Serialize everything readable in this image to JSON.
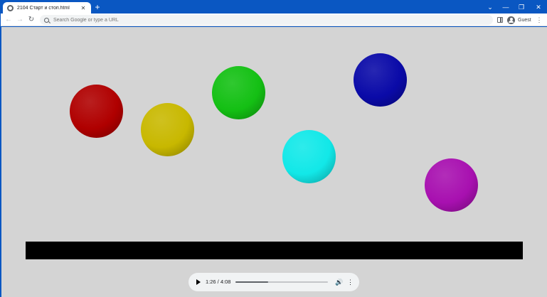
{
  "tab": {
    "title": "2104 Старт и стоп.html",
    "close_glyph": "✕",
    "favicon": "globe-icon"
  },
  "new_tab_glyph": "+",
  "window_controls": {
    "tabsearch": "⌄",
    "minimize": "—",
    "restore": "❐",
    "close": "✕"
  },
  "toolbar": {
    "back_glyph": "←",
    "forward_glyph": "→",
    "reload_glyph": "↻",
    "omnibox_placeholder": "Search Google or type a URL",
    "profile_label": "Guest",
    "menu_glyph": "⋮"
  },
  "balls": [
    {
      "name": "red",
      "color": "#b00000"
    },
    {
      "name": "yellow",
      "color": "#c8b800"
    },
    {
      "name": "green",
      "color": "#14c014"
    },
    {
      "name": "cyan",
      "color": "#12e8e8"
    },
    {
      "name": "blue",
      "color": "#0a0aa8"
    },
    {
      "name": "magenta",
      "color": "#a810b0"
    }
  ],
  "player": {
    "play_glyph": "▶",
    "time": "1:26 / 4:08",
    "progress": 0.35,
    "volume_glyph": "🔊",
    "more_glyph": "⋮"
  }
}
